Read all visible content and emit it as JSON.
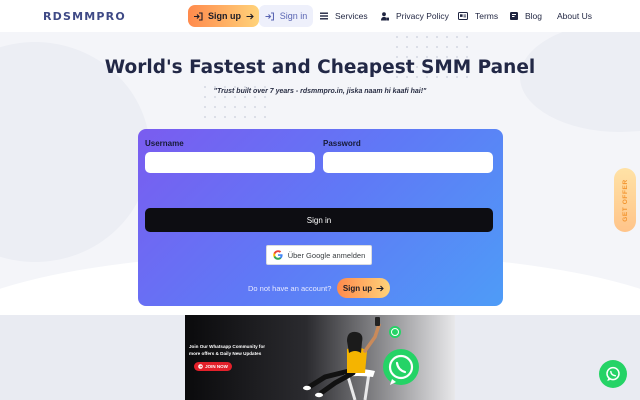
{
  "brand": {
    "logo_text": "RDSMMPRO"
  },
  "nav": {
    "signup_label": "Sign up",
    "signin_label": "Sign in",
    "items": [
      {
        "label": "Services",
        "icon": "list-icon"
      },
      {
        "label": "Privacy Policy",
        "icon": "user-lock-icon"
      },
      {
        "label": "Terms",
        "icon": "id-card-icon"
      },
      {
        "label": "Blog",
        "icon": "blog-icon"
      },
      {
        "label": "About Us",
        "icon": ""
      }
    ]
  },
  "hero": {
    "title": "World's Fastest and Cheapest SMM Panel",
    "tagline": "\"Trust built over 7 years - rdsmmpro.in, jiska naam hi kaafi hai!\""
  },
  "login": {
    "username_label": "Username",
    "password_label": "Password",
    "username_value": "",
    "password_value": "",
    "signin_button": "Sign in",
    "google_button": "Über Google anmelden",
    "no_account_text": "Do not have an account?",
    "signup_button": "Sign up"
  },
  "offer_tab": {
    "label": "GET OFFER"
  },
  "banner": {
    "line1": "Join Our Whatsapp Community for",
    "line2": "more offers & Daily New Updates",
    "join_label": "JOIN NOW"
  },
  "colors": {
    "accent_orange": "#ff8a4c",
    "card_gradient_start": "#7a5cf0",
    "card_gradient_end": "#4e9cf7",
    "whatsapp_green": "#25d366"
  }
}
